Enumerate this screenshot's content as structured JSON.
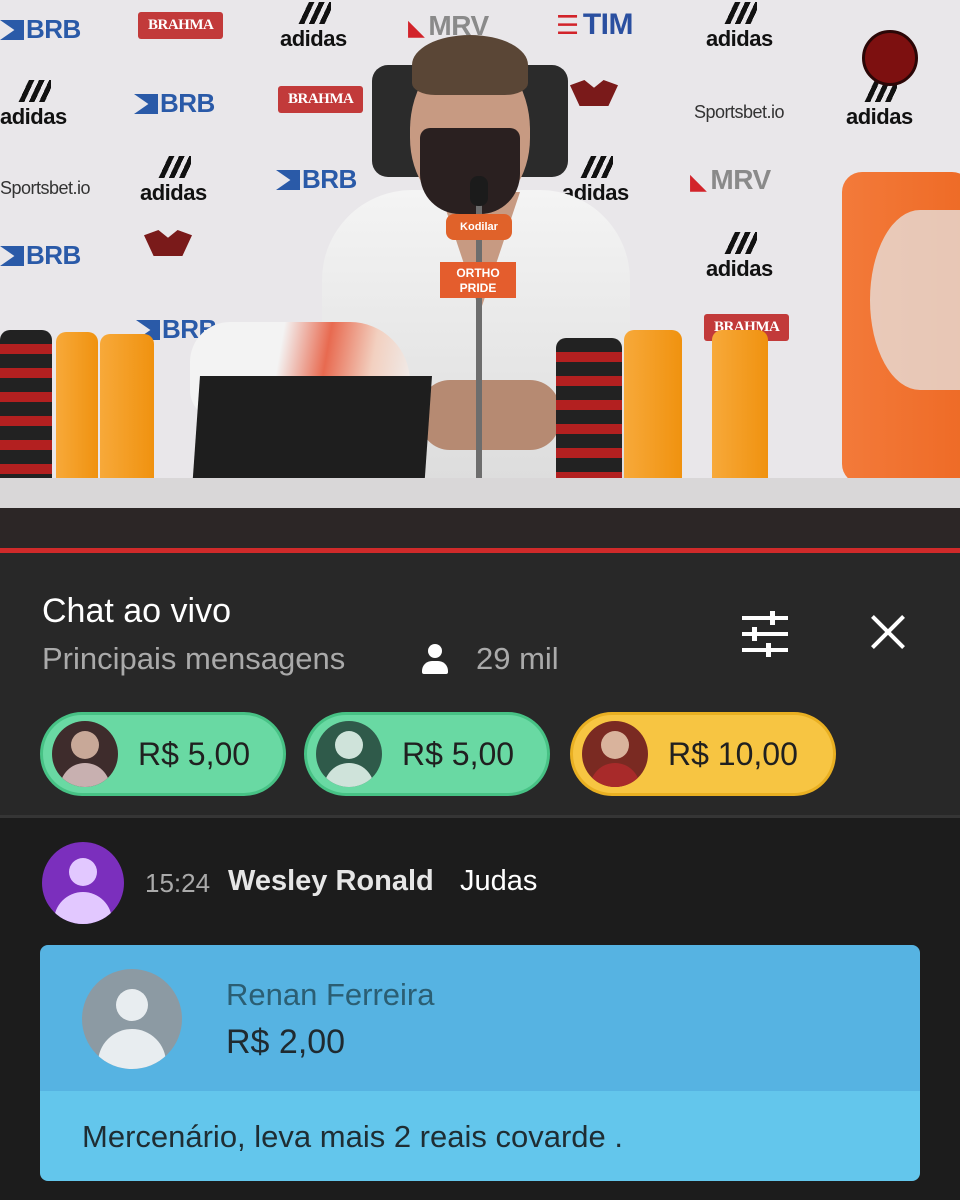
{
  "video": {
    "sponsors": [
      "BRB",
      "BRAHMA",
      "adidas",
      "MRV",
      "TIM",
      "Sportsbet.io"
    ],
    "channel_badge": "FLA TV",
    "mic_flags": [
      "Kodilar",
      "ORTHO PRIDE"
    ],
    "progress_bar_color": "#cf2a2a"
  },
  "chat": {
    "title": "Chat ao vivo",
    "mode": "Principais mensagens",
    "viewers_icon": "person-icon",
    "viewer_count": "29 mil",
    "filter_icon": "tune-icon",
    "close_icon": "close-icon"
  },
  "tickers": [
    {
      "amount": "R$ 5,00",
      "color": "#69d9a3"
    },
    {
      "amount": "R$ 5,00",
      "color": "#69d9a3"
    },
    {
      "amount": "R$ 10,00",
      "color": "#f7c542"
    }
  ],
  "message": {
    "time": "15:24",
    "author": "Wesley Ronald",
    "text": "Judas",
    "avatar_color": "#7b2fbd"
  },
  "superchat": {
    "author": "Renan Ferreira",
    "amount": "R$ 2,00",
    "text": "Mercenário, leva mais 2 reais covarde .",
    "header_color": "#56b3e2",
    "body_color": "#63c6ec"
  }
}
